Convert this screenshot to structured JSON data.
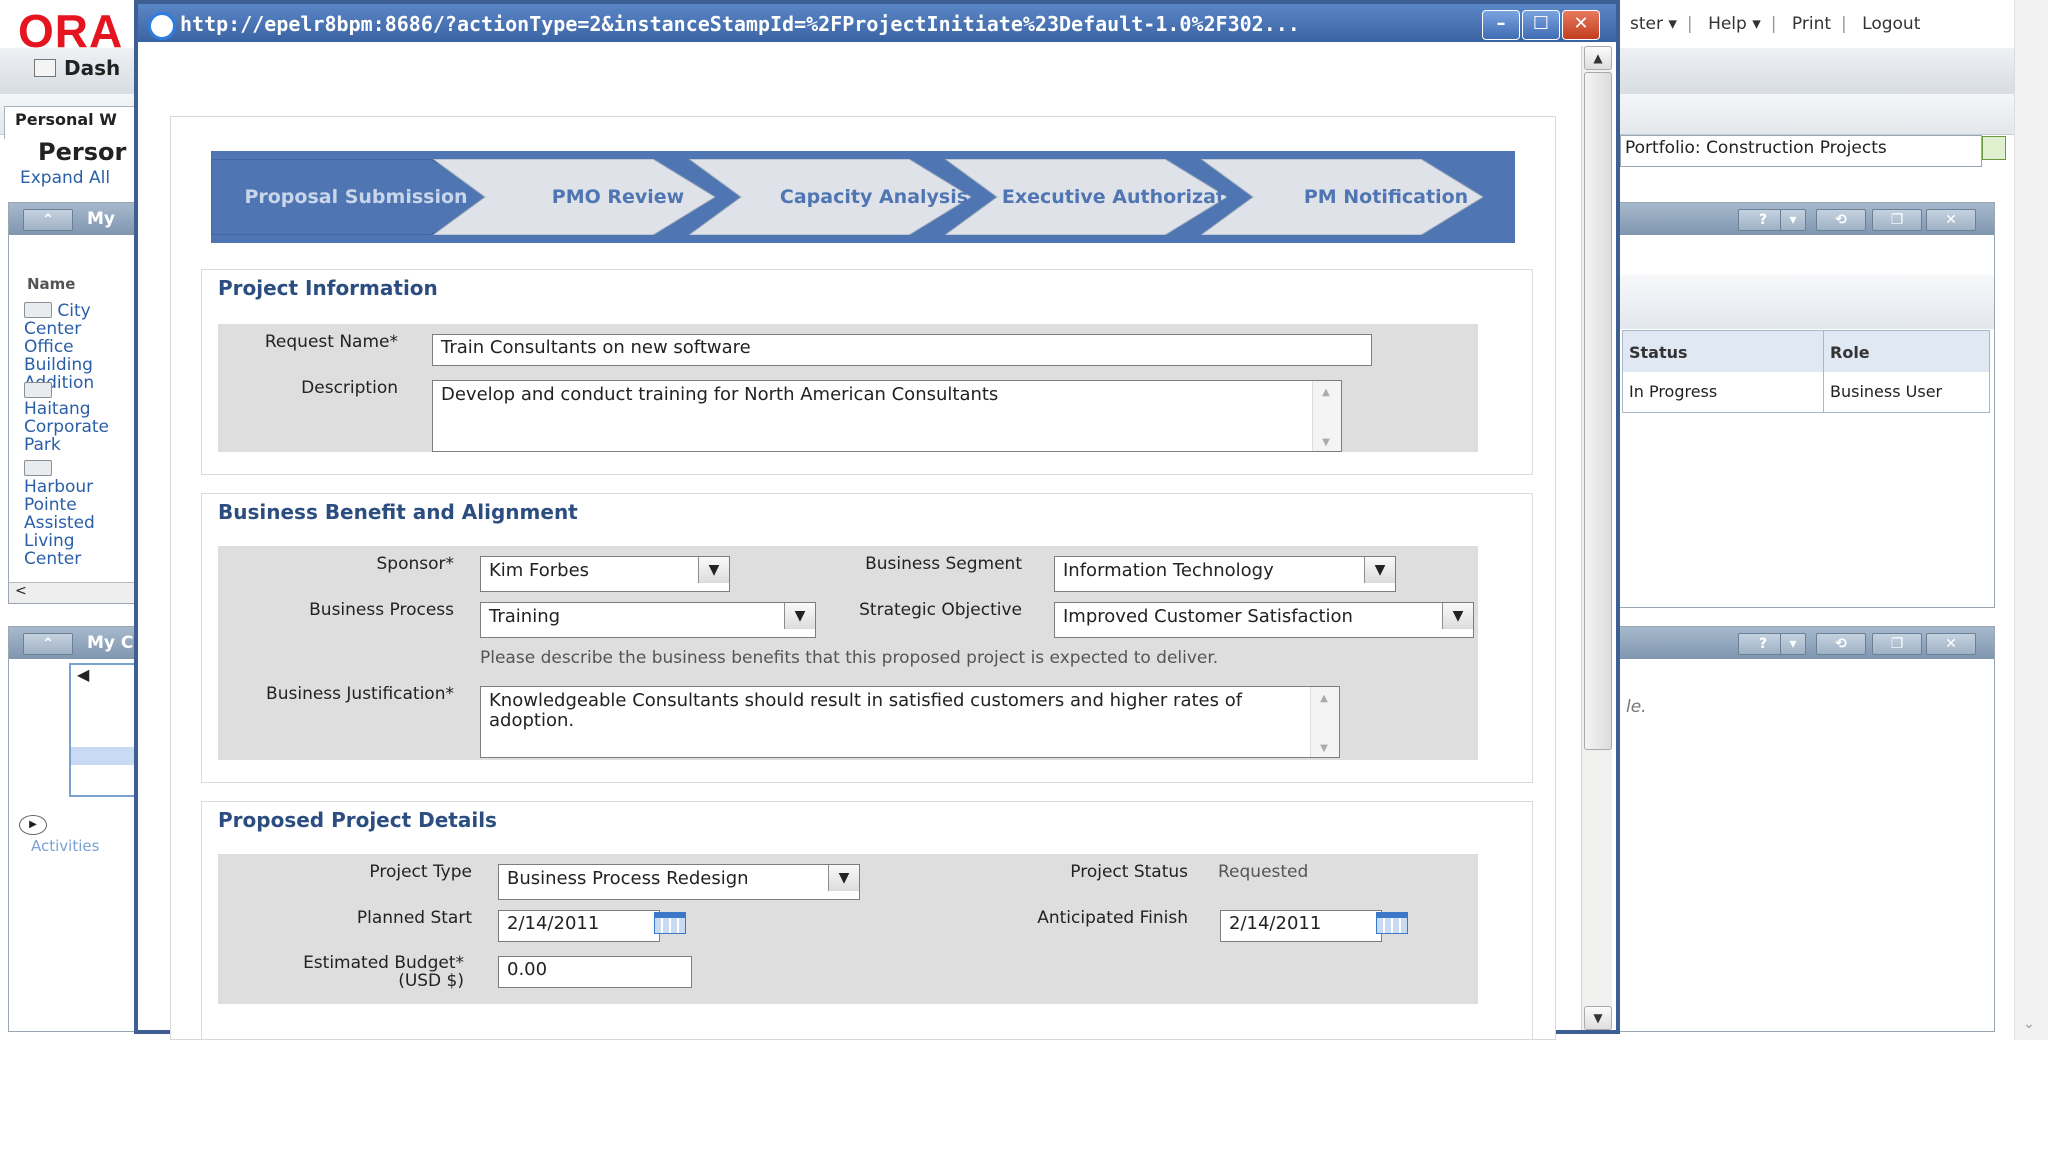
{
  "background": {
    "logo": "ORA",
    "top_links": [
      "ster ▾",
      "Help ▾",
      "Print",
      "Logout"
    ],
    "dashboard_label": "Dash",
    "personal_tab": "Personal W",
    "personal_title": "Persor",
    "expand_all": "Expand All",
    "portlet1_title": "My",
    "portlet2_title": "My C",
    "list_header": "Name",
    "projects": [
      "City Center Office Building Addition",
      "Haitang Corporate Park",
      "Harbour Pointe Assisted Living Center"
    ],
    "activities_link": "Activities",
    "portfolio_field": "Portfolio: Construction Projects",
    "grid_headers": [
      "Status",
      "Role"
    ],
    "grid_row": [
      "In Progress",
      "Business User"
    ],
    "trailing_text": "le."
  },
  "popup": {
    "url": "http://epelr8bpm:8686/?actionType=2&instanceStampId=%2FProjectInitiate%23Default-1.0%2F302...",
    "train": [
      {
        "label": "Proposal Submission",
        "active": true
      },
      {
        "label": "PMO Review",
        "active": false
      },
      {
        "label": "Capacity Analysis",
        "active": false
      },
      {
        "label": "Executive Authorization",
        "active": false
      },
      {
        "label": "PM Notification",
        "active": false
      }
    ],
    "project_information": {
      "title": "Project Information",
      "request_name_label": "Request Name*",
      "request_name_value": "Train Consultants on new software",
      "description_label": "Description",
      "description_value": "Develop and conduct training for North American Consultants"
    },
    "business_benefit": {
      "title": "Business Benefit and Alignment",
      "sponsor_label": "Sponsor*",
      "sponsor_value": "Kim Forbes",
      "segment_label": "Business Segment",
      "segment_value": "Information Technology",
      "process_label": "Business Process",
      "process_value": "Training",
      "objective_label": "Strategic Objective",
      "objective_value": "Improved Customer Satisfaction",
      "hint": "Please describe the business benefits that this proposed project is expected to deliver.",
      "justification_label": "Business Justification*",
      "justification_value": "Knowledgeable Consultants should result in satisfied customers and higher rates of adoption."
    },
    "project_details": {
      "title": "Proposed Project Details",
      "type_label": "Project Type",
      "type_value": "Business Process Redesign",
      "status_label": "Project Status",
      "status_value": "Requested",
      "start_label": "Planned Start",
      "start_value": "2/14/2011",
      "finish_label": "Anticipated Finish",
      "finish_value": "2/14/2011",
      "budget_label": "Estimated Budget*",
      "budget_sub": "(USD $)",
      "budget_value": "0.00"
    }
  },
  "colors": {
    "title_bar": "#3a63a3",
    "train_active": "#4f76b3",
    "train_inactive": "#d7dce3",
    "section_title": "#2b4d80"
  }
}
